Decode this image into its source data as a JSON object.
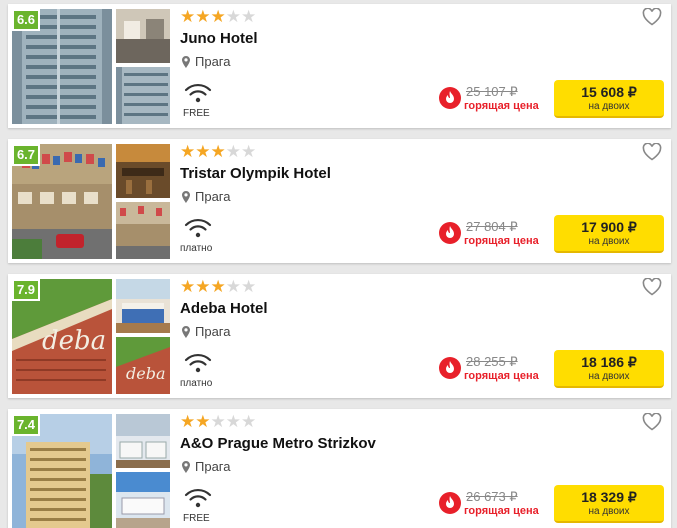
{
  "currency_note": "₽",
  "colors": {
    "rating": "#6ab42d",
    "button": "#ffdd00",
    "hot": "#e8202a",
    "star": "#f5a623"
  },
  "hotels": [
    {
      "rating": "6.6",
      "stars": 3,
      "name": "Juno Hotel",
      "location": "Прага",
      "wifi_label": "FREE",
      "old_price": "25 107 ₽",
      "hot_label": "горящая цена",
      "price": "15 608 ₽",
      "per": "на двоих",
      "icons": {
        "location": "map-pin-icon",
        "wifi": "wifi-icon",
        "hot": "fire-icon",
        "favorite": "heart-icon"
      }
    },
    {
      "rating": "6.7",
      "stars": 3,
      "name": "Tristar Olympik Hotel",
      "location": "Прага",
      "wifi_label": "платно",
      "old_price": "27 804 ₽",
      "hot_label": "горящая цена",
      "price": "17 900 ₽",
      "per": "на двоих",
      "icons": {
        "location": "map-pin-icon",
        "wifi": "wifi-icon",
        "hot": "fire-icon",
        "favorite": "heart-icon"
      }
    },
    {
      "rating": "7.9",
      "stars": 3,
      "name": "Adeba Hotel",
      "location": "Прага",
      "wifi_label": "платно",
      "old_price": "28 255 ₽",
      "hot_label": "горящая цена",
      "price": "18 186 ₽",
      "per": "на двоих",
      "icons": {
        "location": "map-pin-icon",
        "wifi": "wifi-icon",
        "hot": "fire-icon",
        "favorite": "heart-icon"
      }
    },
    {
      "rating": "7.4",
      "stars": 2,
      "name": "A&O Prague Metro Strizkov",
      "location": "Прага",
      "wifi_label": "FREE",
      "old_price": "26 673 ₽",
      "hot_label": "горящая цена",
      "price": "18 329 ₽",
      "per": "на двоих",
      "icons": {
        "location": "map-pin-icon",
        "wifi": "wifi-icon",
        "hot": "fire-icon",
        "favorite": "heart-icon"
      }
    }
  ]
}
